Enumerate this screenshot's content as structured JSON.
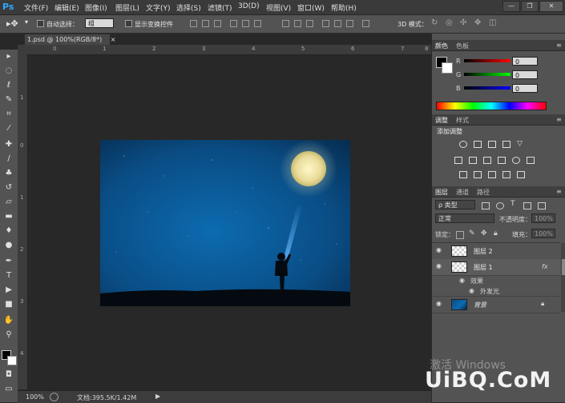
{
  "app": {
    "logo": "Ps"
  },
  "menu": [
    "文件(F)",
    "编辑(E)",
    "图像(I)",
    "图层(L)",
    "文字(Y)",
    "选择(S)",
    "滤镜(T)",
    "3D(D)",
    "视图(V)",
    "窗口(W)",
    "帮助(H)"
  ],
  "window_controls": [
    "minimize",
    "restore",
    "close"
  ],
  "options": {
    "auto_select_label": "自动选择：",
    "auto_select_value": "组",
    "show_transform_label": "显示变换控件",
    "mode_3d_label": "3D 模式："
  },
  "document": {
    "tab_title": "1.psd @ 100%(RGB/8*)",
    "tab_close": "×",
    "zoom": "100%",
    "doc_info": "文档:395.5K/1.42M"
  },
  "rulers": {
    "h_ticks": [
      "0",
      "1",
      "2",
      "3",
      "4",
      "5",
      "6",
      "7",
      "8"
    ],
    "v_ticks": [
      "1",
      "0",
      "1",
      "2",
      "3",
      "4"
    ]
  },
  "color_panel": {
    "tabs": [
      "颜色",
      "色板"
    ],
    "channels": [
      {
        "label": "R",
        "value": "0",
        "color": "#e02020"
      },
      {
        "label": "G",
        "value": "0",
        "color": "#20c020"
      },
      {
        "label": "B",
        "value": "0",
        "color": "#2020e0"
      }
    ]
  },
  "adjust_panel": {
    "tabs": [
      "调整",
      "样式"
    ],
    "title": "添加调整"
  },
  "layers_panel": {
    "tabs": [
      "图层",
      "通道",
      "路径"
    ],
    "filter_label": "ρ 类型",
    "blend_mode": "正常",
    "opacity_label": "不透明度：",
    "opacity_value": "100%",
    "lock_label": "锁定：",
    "fill_label": "填充：",
    "fill_value": "100%",
    "layers": [
      {
        "name": "图层 2",
        "fx": ""
      },
      {
        "name": "图层 1",
        "fx": "fx"
      },
      {
        "name": "背景",
        "fx": ""
      }
    ],
    "effects_label": "效果",
    "effect_item": "外发光"
  },
  "watermark": {
    "activate": "激活 Windows",
    "brand": "UiBQ.CoM"
  },
  "colors": {
    "accent": "#31a8ff",
    "panel": "#535353",
    "canvas_bg": "#282828"
  }
}
